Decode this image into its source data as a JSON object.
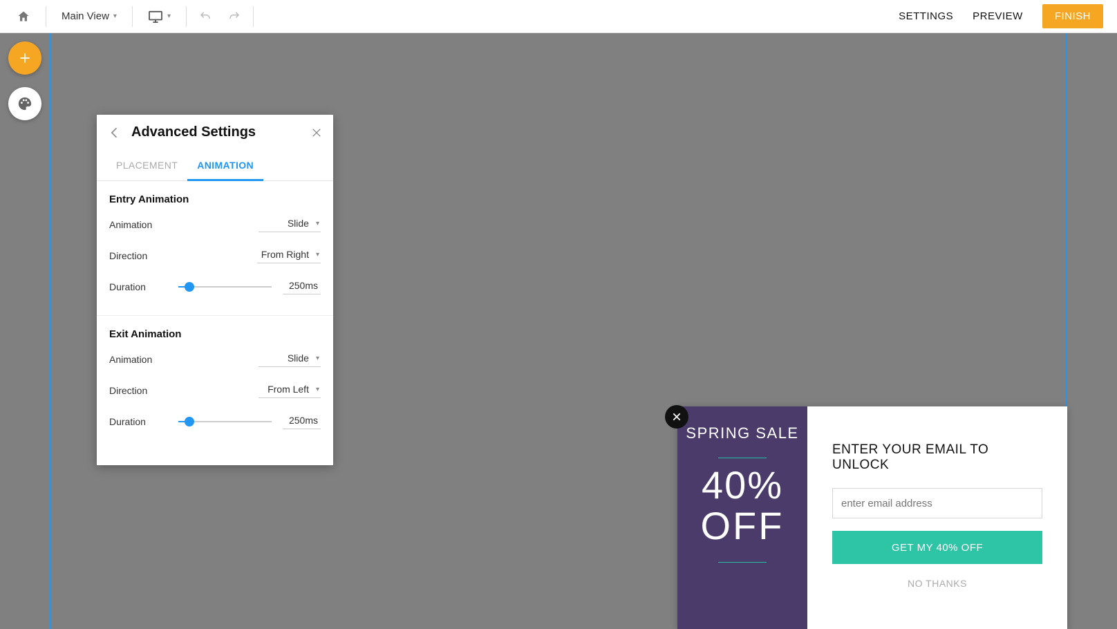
{
  "topbar": {
    "view_label": "Main View",
    "settings": "SETTINGS",
    "preview": "PREVIEW",
    "finish": "FINISH"
  },
  "panel": {
    "title": "Advanced Settings",
    "tabs": {
      "placement": "PLACEMENT",
      "animation": "ANIMATION"
    },
    "entry": {
      "title": "Entry Animation",
      "animation_label": "Animation",
      "animation_value": "Slide",
      "direction_label": "Direction",
      "direction_value": "From Right",
      "duration_label": "Duration",
      "duration_value": "250ms"
    },
    "exit": {
      "title": "Exit Animation",
      "animation_label": "Animation",
      "animation_value": "Slide",
      "direction_label": "Direction",
      "direction_value": "From Left",
      "duration_label": "Duration",
      "duration_value": "250ms"
    }
  },
  "popup": {
    "left": {
      "title": "SPRING SALE",
      "pct": "40%",
      "off": "OFF"
    },
    "right": {
      "title": "ENTER YOUR EMAIL TO UNLOCK",
      "placeholder": "enter email address",
      "cta": "GET MY 40% OFF",
      "no_thanks": "NO THANKS"
    }
  },
  "colors": {
    "accent_orange": "#f5a623",
    "accent_blue": "#2196f3",
    "accent_teal": "#2ec4a6",
    "popup_purple": "#4a3b6b"
  }
}
